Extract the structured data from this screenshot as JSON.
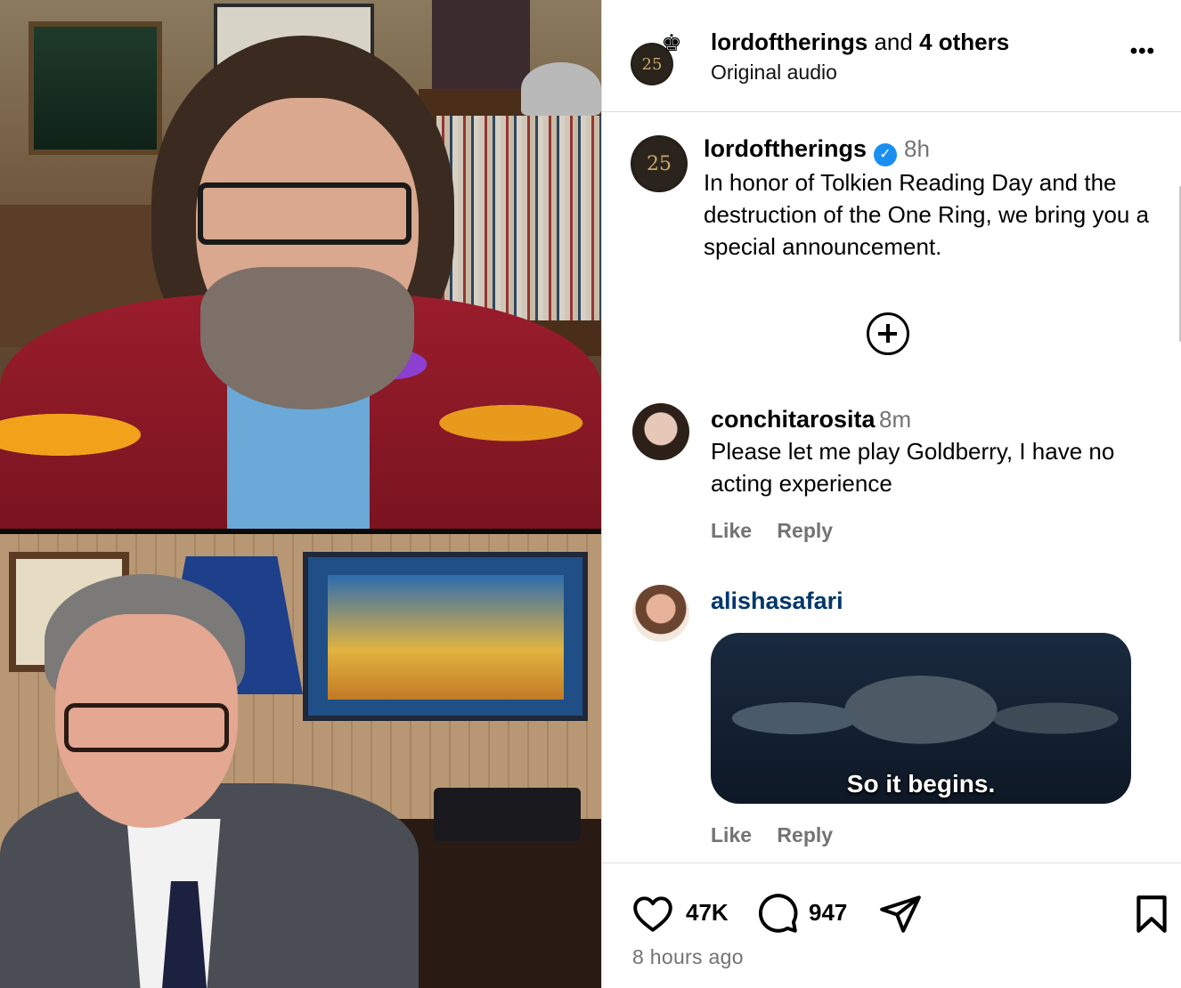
{
  "post": {
    "author": "lordoftherings",
    "coauthors_joiner": "and",
    "coauthors": "4 others",
    "audio": "Original audio",
    "avatar_text": "25",
    "more_label": "•••"
  },
  "caption": {
    "username": "lordoftherings",
    "verified_mark": "✓",
    "time": "8h",
    "text": "In honor of Tolkien Reading Day and the destruction of the One Ring, we bring you a special announcement."
  },
  "comments": [
    {
      "username": "conchitarosita",
      "time": "8m",
      "text": "Please let me play Goldberry, I have no acting experience",
      "like": "Like",
      "reply": "Reply"
    },
    {
      "username": "alishasafari",
      "gif_caption": "So it begins.",
      "like": "Like",
      "reply": "Reply"
    }
  ],
  "footer": {
    "likes": "47K",
    "comments": "947",
    "posted_ago": "8 hours ago"
  },
  "icons": {
    "like": "heart-icon",
    "comment": "speech-bubble-icon",
    "share": "paper-plane-icon",
    "save": "bookmark-icon",
    "load_more": "plus-circle-icon",
    "more": "ellipsis-icon"
  },
  "colors": {
    "verified": "#1a8ff2",
    "muted_text": "#737373",
    "link_username": "#00376b",
    "border": "#dbdbdb"
  }
}
